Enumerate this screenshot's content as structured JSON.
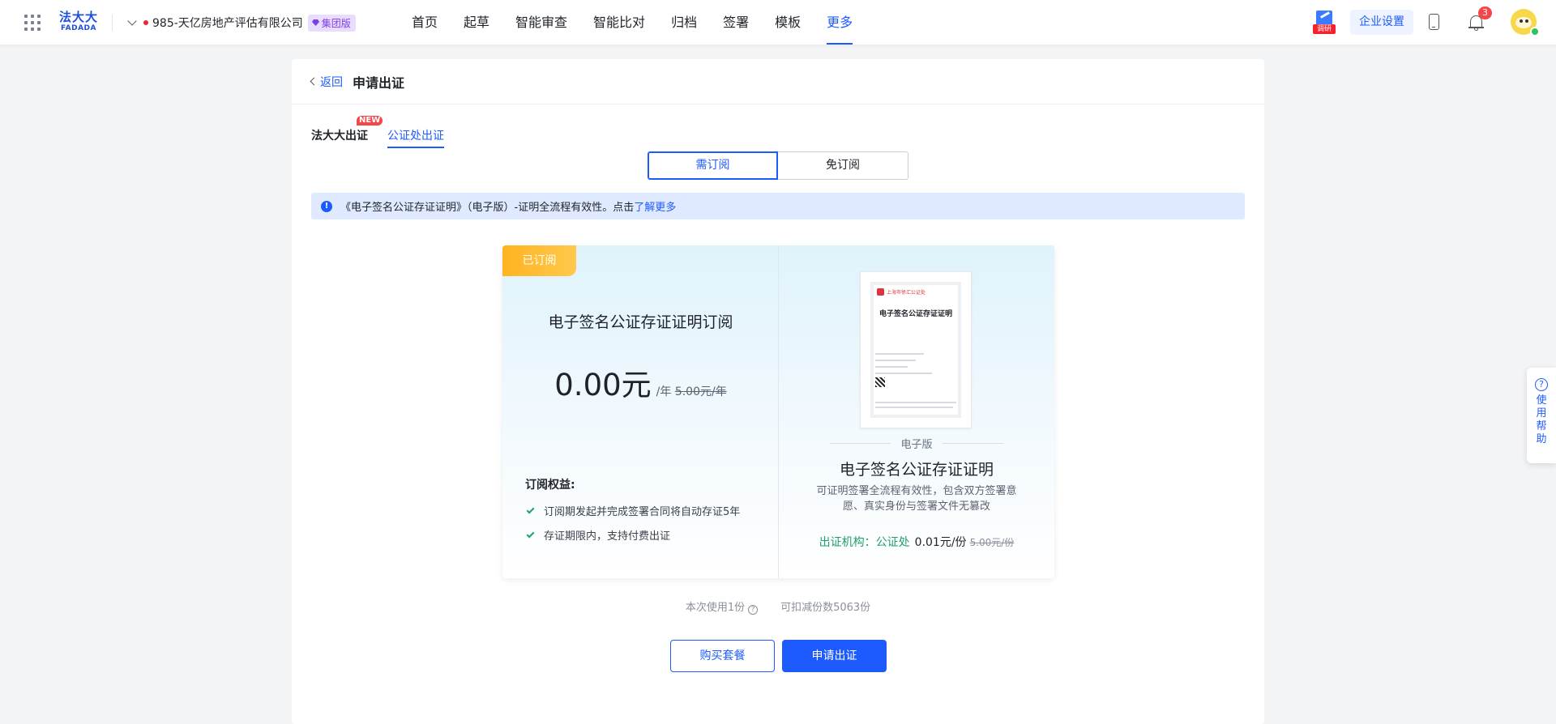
{
  "topbar": {
    "logo_cn": "法大大",
    "logo_en": "FADADA",
    "company": "985-天亿房地产评估有限公司",
    "group_badge": "集团版",
    "menu": [
      {
        "label": "首页",
        "active": false
      },
      {
        "label": "起草",
        "active": false
      },
      {
        "label": "智能审查",
        "active": false
      },
      {
        "label": "智能比对",
        "active": false
      },
      {
        "label": "归档",
        "active": false
      },
      {
        "label": "签署",
        "active": false
      },
      {
        "label": "模板",
        "active": false
      },
      {
        "label": "更多",
        "active": true
      }
    ],
    "research_tag": "调研",
    "enterprise_settings": "企业设置",
    "notification_count": "3"
  },
  "header": {
    "back": "返回",
    "title": "申请出证"
  },
  "subtabs": [
    {
      "label": "法大大出证",
      "active": false,
      "new_tag": "NEW"
    },
    {
      "label": "公证处出证",
      "active": true
    }
  ],
  "segment": {
    "options": [
      "需订阅",
      "免订阅"
    ],
    "selected": "需订阅"
  },
  "notice": {
    "text": "《电子签名公证存证证明》（电子版）-证明全流程有效性。点击",
    "link": "了解更多"
  },
  "plan": {
    "tag": "已订阅",
    "title": "电子签名公证存证证明订阅",
    "price": "0.00元",
    "unit": "/年",
    "old_price": "5.00元/年",
    "benefits_title": "订阅权益:",
    "benefits": [
      "订阅期发起并完成签署合同将自动存证5年",
      "存证期限内，支持付费出证"
    ]
  },
  "certificate": {
    "doc_org": "上海市徐汇公证处",
    "doc_heading": "电子签名公证存证证明",
    "edition": "电子版",
    "title": "电子签名公证存证证明",
    "description": "可证明签署全流程有效性，包含双方签署意愿、真实身份与签署文件无篡改",
    "issuer_label": "出证机构：公证处",
    "price": "0.01元/份",
    "old_price": "5.00元/份"
  },
  "usage": {
    "used": "本次使用1份",
    "remaining": "可扣减份数5063份"
  },
  "actions": {
    "buy": "购买套餐",
    "apply": "申请出证"
  },
  "help_float": {
    "label": "使用帮助"
  }
}
